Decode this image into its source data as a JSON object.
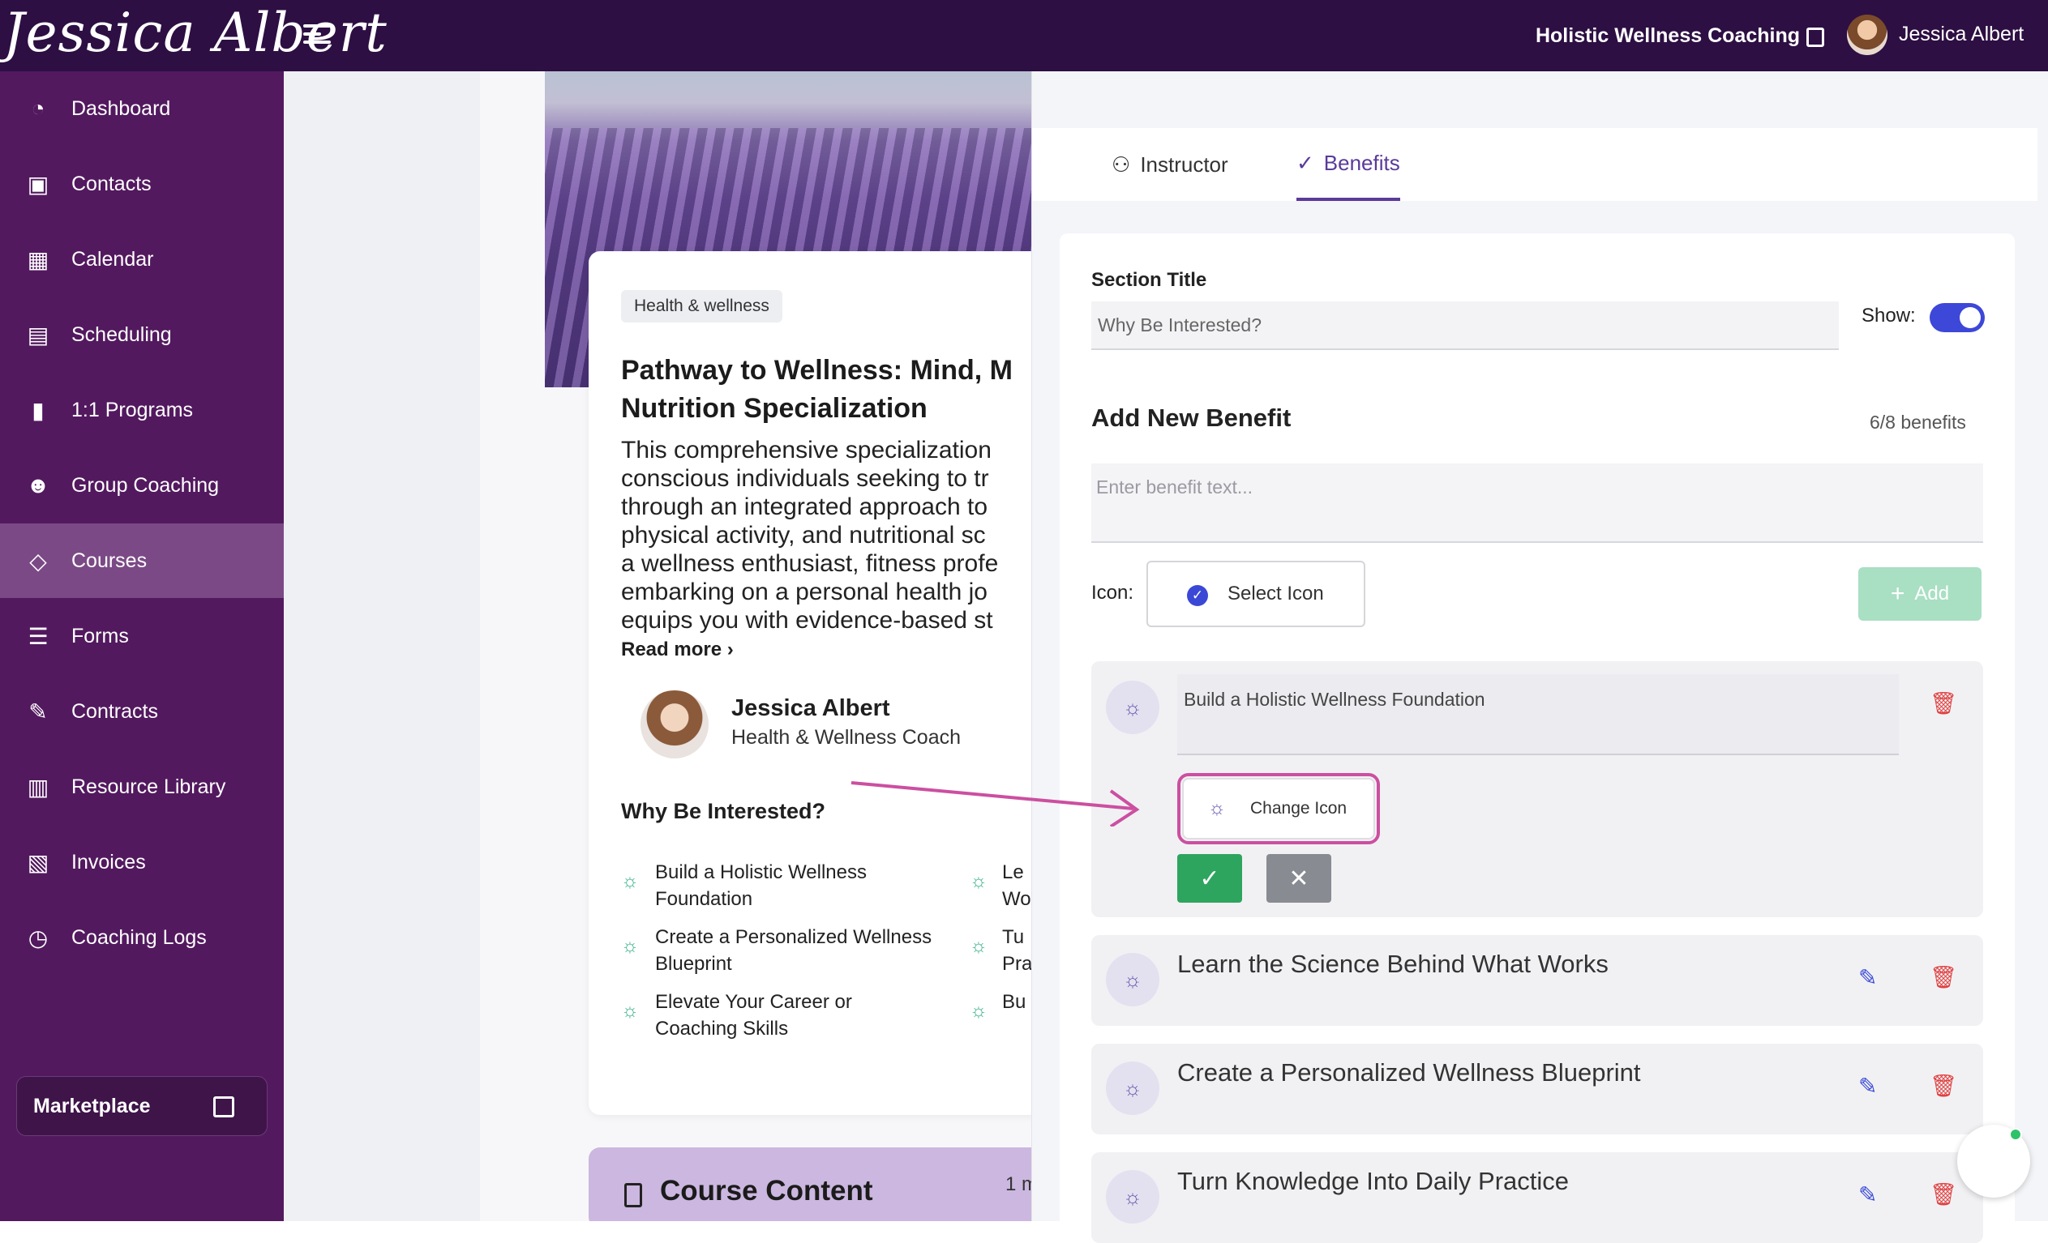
{
  "topbar": {
    "logo_text": "Jessica Albert",
    "business_name": "Holistic Wellness Coaching",
    "user_name": "Jessica Albert"
  },
  "sidebar": {
    "items": [
      {
        "label": "Dashboard",
        "icon": "dashboard-icon"
      },
      {
        "label": "Contacts",
        "icon": "contacts-icon"
      },
      {
        "label": "Calendar",
        "icon": "calendar-icon"
      },
      {
        "label": "Scheduling",
        "icon": "scheduling-icon"
      },
      {
        "label": "1:1 Programs",
        "icon": "book-icon"
      },
      {
        "label": "Group Coaching",
        "icon": "group-icon"
      },
      {
        "label": "Courses",
        "icon": "graduation-cap-icon"
      },
      {
        "label": "Forms",
        "icon": "forms-icon"
      },
      {
        "label": "Contracts",
        "icon": "contract-icon"
      },
      {
        "label": "Resource Library",
        "icon": "library-icon"
      },
      {
        "label": "Invoices",
        "icon": "invoice-icon"
      },
      {
        "label": "Coaching Logs",
        "icon": "clock-icon"
      }
    ],
    "active": "Courses",
    "marketplace_label": "Marketplace"
  },
  "preview": {
    "tag": "Health & wellness",
    "title": "Pathway to Wellness: Mind, M\nNutrition Specialization",
    "description": "This comprehensive specialization\nconscious individuals seeking to tr\nthrough an integrated approach to\nphysical activity, and nutritional sc\na wellness enthusiast, fitness profe\nembarking on a personal health jo\nequips you with evidence-based st",
    "read_more": "Read more",
    "instructor_name": "Jessica Albert",
    "instructor_role": "Health & Wellness Coach",
    "why_heading": "Why Be Interested?",
    "benefits_left": [
      "Build a Holistic Wellness\nFoundation",
      "Create a Personalized Wellness\nBlueprint",
      "Elevate Your Career or\nCoaching Skills"
    ],
    "benefits_right": [
      "Le\nWo",
      "Tu\nPra",
      "Bu"
    ],
    "course_content_title": "Course Content",
    "course_content_count": "1 m"
  },
  "editor": {
    "tabs": [
      {
        "label": "Instructor",
        "icon": "user-icon"
      },
      {
        "label": "Benefits",
        "icon": "check-icon"
      }
    ],
    "selected_tab": "Benefits",
    "section_title_label": "Section Title",
    "section_title_value": "Why Be Interested?",
    "show_label": "Show:",
    "show_enabled": true,
    "add_heading": "Add New Benefit",
    "benefit_count": "6/8 benefits",
    "benefit_placeholder": "Enter benefit text...",
    "icon_label": "Icon:",
    "select_icon_label": "Select Icon",
    "add_label": "Add",
    "editing_item": {
      "text": "Build a Holistic Wellness Foundation",
      "change_icon_label": "Change Icon"
    },
    "items": [
      "Learn the Science Behind What Works",
      "Create a Personalized Wellness Blueprint",
      "Turn Knowledge Into Daily Practice"
    ]
  },
  "colors": {
    "topbar": "#2d0f43",
    "sidebar": "#53195f",
    "accent": "#5a3a9a",
    "highlight": "#cc4fa0",
    "confirm": "#2ea55e"
  }
}
